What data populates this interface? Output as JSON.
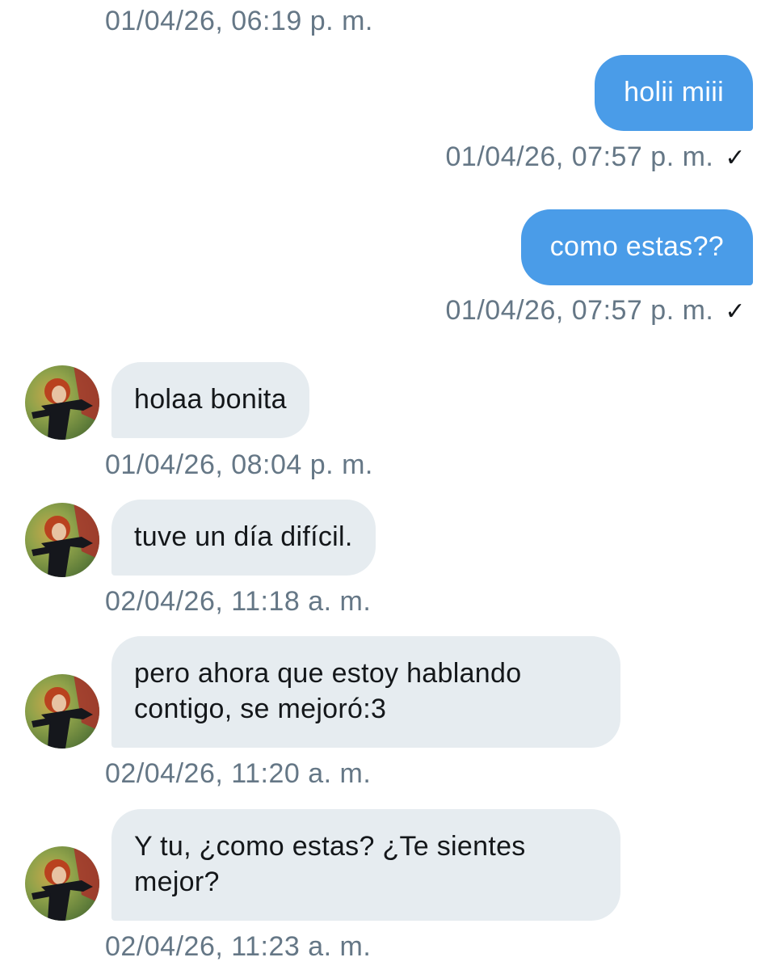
{
  "conversation": {
    "top_timestamp": "01/04/26, 06:19 p. m.",
    "messages": [
      {
        "direction": "outgoing",
        "text": "holii miii",
        "timestamp": "01/04/26, 07:57 p. m.",
        "status": "✓"
      },
      {
        "direction": "outgoing",
        "text": "como estas??",
        "timestamp": "01/04/26, 07:57 p. m.",
        "status": "✓"
      },
      {
        "direction": "incoming",
        "text": "holaa bonita",
        "timestamp": "01/04/26, 08:04 p. m."
      },
      {
        "direction": "incoming",
        "text": "tuve un día difícil.",
        "timestamp": "02/04/26, 11:18 a. m."
      },
      {
        "direction": "incoming",
        "text_lines": [
          "pero ahora que estoy hablando",
          "contigo, se mejoró:3"
        ],
        "timestamp": "02/04/26, 11:20 a. m."
      },
      {
        "direction": "incoming",
        "text_lines": [
          "Y tu, ¿como estas? ¿Te sientes",
          "mejor?"
        ],
        "timestamp": "02/04/26, 11:23 a. m."
      }
    ]
  },
  "colors": {
    "outgoing_bubble": "#4a9ce8",
    "incoming_bubble": "#e6ecf0",
    "timestamp_text": "#657786"
  },
  "icons": {
    "avatar": "contact-avatar",
    "read_receipt": "checkmark-icon"
  }
}
